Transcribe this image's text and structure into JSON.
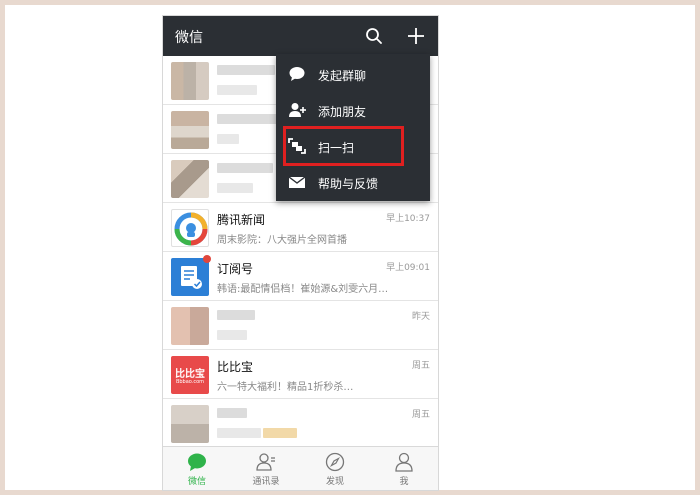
{
  "header": {
    "title": "微信"
  },
  "menu": {
    "items": [
      {
        "label": "发起群聊",
        "icon": "chat-bubble-icon"
      },
      {
        "label": "添加朋友",
        "icon": "add-friend-icon"
      },
      {
        "label": "扫一扫",
        "icon": "scan-icon"
      },
      {
        "label": "帮助与反馈",
        "icon": "mail-icon"
      }
    ]
  },
  "chats": [
    {
      "name": "",
      "preview": "",
      "time": ""
    },
    {
      "name": "",
      "preview": "",
      "time": ""
    },
    {
      "name": "",
      "preview": "",
      "time": ""
    },
    {
      "name": "腾讯新闻",
      "preview": "周末影院：八大强片全网首播",
      "time": "早上10:37"
    },
    {
      "name": "订阅号",
      "preview": "韩语:最配情侣档！崔始源&刘雯六月…",
      "time": "早上09:01"
    },
    {
      "name": "",
      "preview": "",
      "time": "昨天"
    },
    {
      "name": "比比宝",
      "preview": "六一特大福利！精品1折秒杀…",
      "time": "周五",
      "avatar_text": "比比宝",
      "avatar_sub": "Bbbao.com"
    },
    {
      "name": "",
      "preview": "",
      "time": "周五"
    }
  ],
  "tabs": [
    {
      "label": "微信",
      "icon": "chat-icon",
      "active": true
    },
    {
      "label": "通讯录",
      "icon": "contacts-icon",
      "active": false
    },
    {
      "label": "发现",
      "icon": "compass-icon",
      "active": false
    },
    {
      "label": "我",
      "icon": "person-icon",
      "active": false
    }
  ],
  "colors": {
    "accent": "#2fb34a",
    "titlebar": "#2b2f34",
    "highlight": "#e02020"
  }
}
